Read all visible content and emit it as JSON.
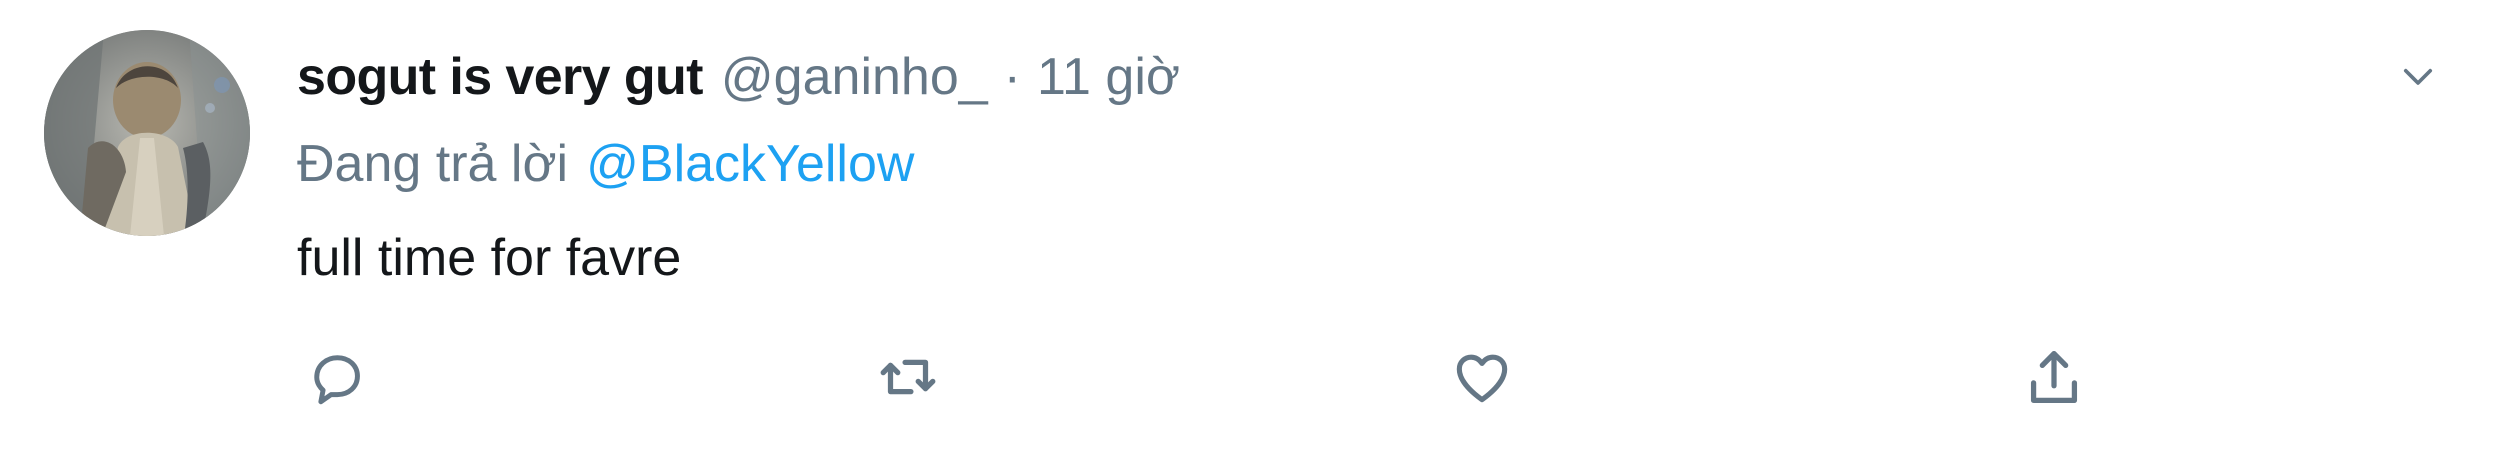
{
  "tweet": {
    "author": {
      "display_name": "sogut is very gut",
      "handle": "@ganinho_",
      "separator": "·",
      "time": "11 giờ"
    },
    "reply_context": {
      "prefix": "Đang trả lời",
      "mention": "@BlackYellow"
    },
    "text": "full time for favre"
  },
  "icons": {
    "menu": "chevron-down-icon",
    "reply": "reply-icon",
    "retweet": "retweet-icon",
    "like": "heart-icon",
    "share": "share-icon"
  },
  "colors": {
    "primary_text": "#14171a",
    "secondary_text": "#657786",
    "link": "#1da1f2",
    "background": "#ffffff"
  }
}
